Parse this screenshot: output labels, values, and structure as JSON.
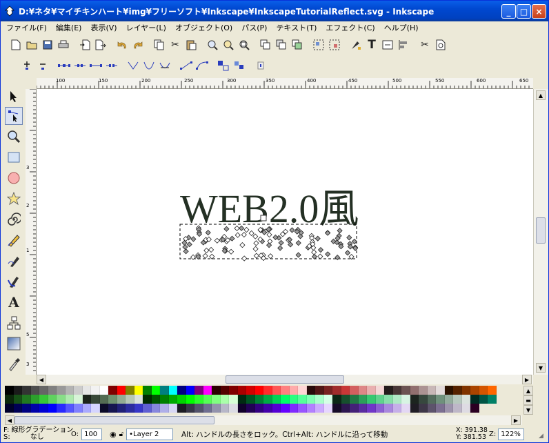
{
  "window": {
    "title": "D:¥ネタ¥マイチキンハート¥img¥フリーソフト¥Inkscape¥InkscapeTutorialReflect.svg - Inkscape",
    "minimize": "_",
    "maximize": "□",
    "close": "×"
  },
  "menu": [
    "ファイル(F)",
    "編集(E)",
    "表示(V)",
    "レイヤー(L)",
    "オブジェクト(O)",
    "パス(P)",
    "テキスト(T)",
    "エフェクト(C)",
    "ヘルプ(H)"
  ],
  "ruler": {
    "h_labels": [
      "100",
      "150",
      "200",
      "250",
      "300",
      "350",
      "400",
      "450",
      "500",
      "550",
      "600",
      "650"
    ],
    "v_labels": [
      "3",
      "2",
      "1",
      "5",
      "3"
    ]
  },
  "canvas": {
    "text": "WEB2.0風"
  },
  "status": {
    "fill_label": "F:",
    "fill_value": "線形グラデーション",
    "stroke_label": "S:",
    "stroke_value": "なし",
    "opacity_label": "O:",
    "opacity_value": "100",
    "layer_value": "•Layer 2",
    "message": "Alt: ハンドルの長さをロック。Ctrl+Alt: ハンドルに沿って移動",
    "x_coord": "X: 391.38",
    "y_coord": "Y: 381.53",
    "zoom_label": "Z:",
    "zoom_value": "122%"
  },
  "palette_colors": [
    [
      "#000000",
      "#1a1a1a",
      "#333333",
      "#4d4d4d",
      "#666666",
      "#808080",
      "#999999",
      "#b3b3b3",
      "#cccccc",
      "#e6e6e6",
      "#f2f2f2",
      "#ffffff",
      "#800000",
      "#ff0000",
      "#808000",
      "#ffff00",
      "#008000",
      "#00ff00",
      "#008080",
      "#00ffff",
      "#000080",
      "#0000ff",
      "#800080",
      "#ff00ff",
      "#2b0000",
      "#550000",
      "#800000",
      "#aa0000",
      "#d40000",
      "#ff0000",
      "#ff2a2a",
      "#ff5555",
      "#ff8080",
      "#ffaaaa",
      "#ffd5d5",
      "#280b0b",
      "#501616",
      "#782121",
      "#a02c2c",
      "#c83737",
      "#d35f5f",
      "#de8787",
      "#e9afaf",
      "#f4d7d7",
      "#241c1c",
      "#483737",
      "#6c5353",
      "#916f6f",
      "#ac9393",
      "#c8b7b7",
      "#e3dbdb",
      "#2b1100",
      "#552200",
      "#803300",
      "#aa4400",
      "#d45500",
      "#ff6600"
    ],
    [
      "#0b280b",
      "#165016",
      "#217821",
      "#2ca02c",
      "#37c837",
      "#5fd35f",
      "#87de87",
      "#afe9af",
      "#d7f4d7",
      "#1c241c",
      "#374837",
      "#536c53",
      "#6f916f",
      "#93ac93",
      "#b7c8b7",
      "#dbe3db",
      "#002b00",
      "#005500",
      "#008000",
      "#00aa00",
      "#00d400",
      "#00ff00",
      "#2aff2a",
      "#55ff55",
      "#80ff80",
      "#aaffaa",
      "#d5ffd5",
      "#002b11",
      "#005522",
      "#008033",
      "#00aa44",
      "#00d455",
      "#00ff66",
      "#2aff80",
      "#55ff99",
      "#80ffb3",
      "#aaffcc",
      "#d5ffe6",
      "#0b2816",
      "#16502d",
      "#217844",
      "#2ca05a",
      "#37c871",
      "#5fd38d",
      "#87dea9",
      "#afe9c6",
      "#d7f4e3",
      "#1c241f",
      "#37483e",
      "#536c5d",
      "#6f917c",
      "#93ac9d",
      "#b7c8be",
      "#dbe3de",
      "#002b22",
      "#005544",
      "#008066"
    ],
    [
      "#00002b",
      "#000055",
      "#000080",
      "#0000aa",
      "#0000d4",
      "#0000ff",
      "#2a2aff",
      "#5555ff",
      "#8080ff",
      "#aaaaff",
      "#d5d5ff",
      "#0b0b28",
      "#161650",
      "#212178",
      "#2c2ca0",
      "#3737c8",
      "#5f5fd3",
      "#8787de",
      "#afafe9",
      "#d7d7f4",
      "#1c1c24",
      "#373748",
      "#53536c",
      "#6f6f91",
      "#9393ac",
      "#b7b7c8",
      "#dbdbe3",
      "#11002b",
      "#220055",
      "#330080",
      "#4400aa",
      "#5500d4",
      "#6600ff",
      "#802aff",
      "#9955ff",
      "#b380ff",
      "#ccaaff",
      "#e6d5ff",
      "#160b28",
      "#2d1650",
      "#442178",
      "#5a2ca0",
      "#7137c8",
      "#8d5fd3",
      "#a987de",
      "#c6afe9",
      "#e3d7f4",
      "#1f1c24",
      "#3e3748",
      "#5d536c",
      "#7c6f91",
      "#9d93ac",
      "#beb7c8",
      "#dedbe3",
      "#2b0022"
    ]
  ],
  "colors": {
    "titlebar": "#0048d0",
    "canvas": "#ffffff",
    "text_fill": "#243024"
  }
}
